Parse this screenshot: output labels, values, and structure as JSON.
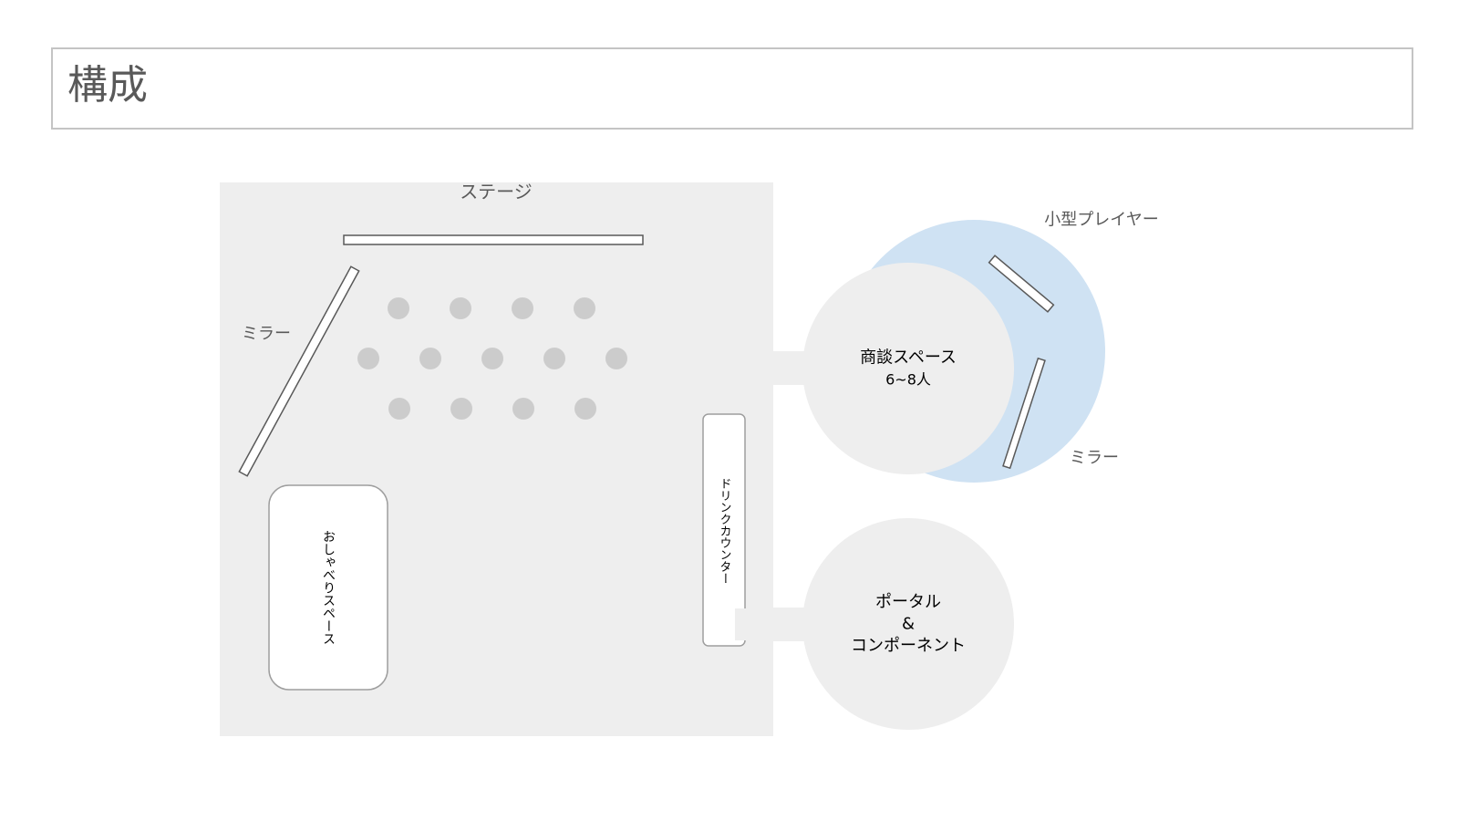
{
  "slide": {
    "title": "構成"
  },
  "layout": {
    "stage_label": "ステージ",
    "mirror_label_left": "ミラー",
    "mirror_label_right": "ミラー",
    "chat_space": "おしゃべりスペース",
    "drink_counter": "ドリンクカウンター",
    "meeting_space_line1": "商談スペース",
    "meeting_space_line2": "6~8人",
    "small_player": "小型プレイヤー",
    "portal_line1": "ポータル",
    "portal_line2": "&",
    "portal_line3": "コンポーネント"
  },
  "colors": {
    "floor": "#eeeeee",
    "seat": "#cccccc",
    "player_area": "#cfe2f3",
    "outline": "#595959",
    "label_grey": "#595959"
  }
}
